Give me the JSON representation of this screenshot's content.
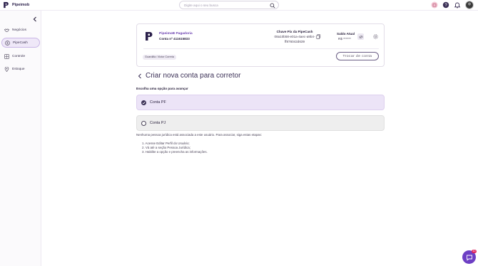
{
  "brand": {
    "name": "Pipeimob"
  },
  "search": {
    "placeholder": "Digite aqui o seu busca"
  },
  "sidebar": {
    "items": [
      {
        "label": "Negócios",
        "icon": "handshake-icon"
      },
      {
        "label": "PipeCash",
        "icon": "dollar-circle-icon",
        "active": true
      },
      {
        "label": "Controle",
        "icon": "grid-icon"
      },
      {
        "label": "Estoque",
        "icon": "map-pin-icon"
      }
    ]
  },
  "account": {
    "bank_name": "PipeimoB Pagadoria",
    "account_number": "Conta nº 411615833",
    "pix_title": "Chave Pix da PipeCash",
    "pix_key_line1": "08a10b58-e01a-4aec-a9b4-",
    "pix_key_line2": "ff876042d639",
    "balance_title": "Saldo Atual",
    "balance_value": "R$ ******",
    "holder": "Guardião: Victor Correia",
    "switch_label": "Trocar de conta"
  },
  "main": {
    "title": "Criar nova conta para corretor",
    "subtitle": "Escolha uma opção para avançar",
    "options": [
      {
        "label": "Conta PF",
        "selected": true
      },
      {
        "label": "Conta PJ",
        "selected": false
      }
    ],
    "info": "Nenhuma pessoa jurídica está associada a este usuário. Para associar, siga estas etapas:",
    "steps": [
      "1. Acesse Editar Perfil do Usuário;",
      "2. Vá até a seção Pessoa Jurídica;",
      "3. Habilite a opção e preencha as informações."
    ]
  },
  "chat": {
    "badge": "10"
  },
  "colors": {
    "accent": "#6d3fc4",
    "brand": "#2a1f4a"
  }
}
